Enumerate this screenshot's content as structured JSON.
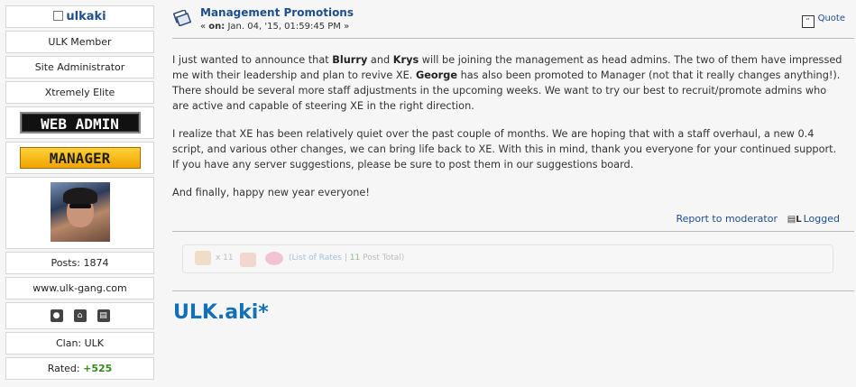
{
  "profile": {
    "username": "ulkaki",
    "group": "ULK Member",
    "title": "Site Administrator",
    "rank": "Xtremely Elite",
    "badges": [
      "WEB ADMIN",
      "MANAGER"
    ],
    "posts": "Posts: 1874",
    "website": "www.ulk-gang.com",
    "icons": [
      "profile-icon",
      "home-icon",
      "blog-icon"
    ],
    "clan": "Clan: ULK",
    "rated_label": "Rated:",
    "rated_value": "+525"
  },
  "post": {
    "title": "Management Promotions",
    "date_prefix": "on:",
    "date": "Jan. 04, '15, 01:59:45 PM »",
    "quote_label": "Quote",
    "paragraph1": {
      "t1": "I just wanted to announce that ",
      "b1": "Blurry",
      "t2": " and ",
      "b2": "Krys",
      "t3": " will be joining the management as head admins. The two of them have impressed me with their leadership and plan to revive XE. ",
      "b3": "George",
      "t4": " has also been promoted to Manager (not that it really changes anything!). There should be several more staff adjustments in the upcoming weeks. We want to try our best to recruit/promote admins who are active and capable of steering XE in the right direction."
    },
    "paragraph2": "I realize that XE has been relatively quiet over the past couple of months. We are hoping that with a staff overhaul, a new 0.4 script, and various other changes, we can bring life back to XE. With this in mind, thank you everyone for your continued support. If you have any server suggestions, please be sure to post them in our suggestions board.",
    "paragraph3": "And finally, happy new year everyone!",
    "report_label": "Report to moderator",
    "logged_label": "Logged",
    "rates": {
      "up_count": "x 11",
      "list_label": "(List of Rates",
      "separator": "|",
      "total_num": "11",
      "total_label": "Post Total)"
    },
    "signature": "ULK.aki*"
  }
}
